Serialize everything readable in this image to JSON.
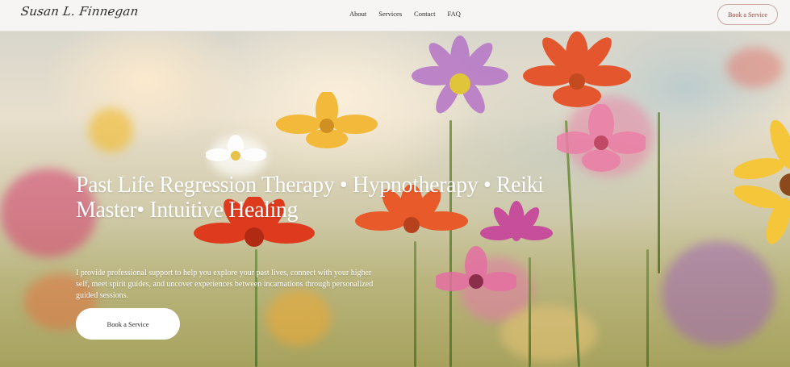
{
  "header": {
    "logo_text": "Susan L. Finnegan",
    "nav": [
      {
        "label": "About"
      },
      {
        "label": "Services"
      },
      {
        "label": "Contact"
      },
      {
        "label": "FAQ"
      }
    ],
    "cta_label": "Book a Service"
  },
  "hero": {
    "title": "Past Life Regression Therapy • Hypnotherapy • Reiki Master• Intuitive Healing",
    "subtitle": "I provide professional support to help you explore your past lives, connect with your higher self, meet spirit guides, and uncover experiences between incarnations through personalized guided sessions.",
    "cta_label": "Book a Service"
  },
  "colors": {
    "accent_border": "#c9a9a2",
    "accent_text": "#8a4a42",
    "header_bg": "#f6f5f3"
  }
}
